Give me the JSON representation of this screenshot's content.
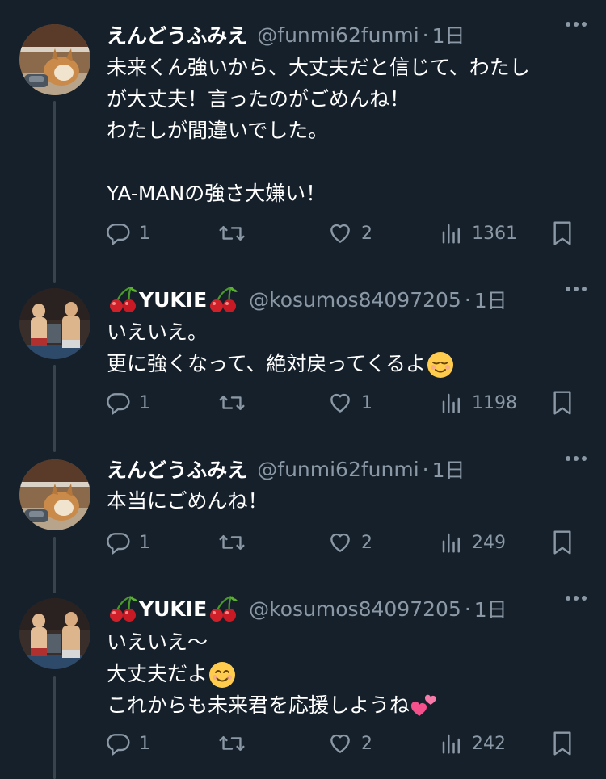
{
  "tweets": [
    {
      "name": "えんどうふみえ",
      "handle": "@funmi62funmi",
      "dot": "·",
      "time": "1日",
      "lines": [
        "未来くん強いから、大丈夫だと信じて、わたし",
        "が大丈夫！言ったのがごめんね！",
        "わたしが間違いでした。",
        "",
        "YA-MANの強さ大嫌い！"
      ],
      "replies": "1",
      "retweets": "",
      "likes": "2",
      "views": "1361"
    },
    {
      "name": "YUKIE",
      "handle": "@kosumos84097205",
      "dot": "·",
      "time": "1日",
      "lines": [
        "いえいえ。",
        "更に強くなって、絶対戻ってくるよ"
      ],
      "replies": "1",
      "retweets": "",
      "likes": "1",
      "views": "1198"
    },
    {
      "name": "えんどうふみえ",
      "handle": "@funmi62funmi",
      "dot": "·",
      "time": "1日",
      "lines": [
        "本当にごめんね！"
      ],
      "replies": "1",
      "retweets": "",
      "likes": "2",
      "views": "249"
    },
    {
      "name": "YUKIE",
      "handle": "@kosumos84097205",
      "dot": "·",
      "time": "1日",
      "lines": [
        "いえいえ〜",
        "大丈夫だよ",
        "これからも未来君を応援しようね"
      ],
      "replies": "1",
      "retweets": "",
      "likes": "2",
      "views": "242"
    }
  ],
  "icons": {
    "reply": "reply-icon",
    "retweet": "retweet-icon",
    "like": "heart-icon",
    "views": "views-icon",
    "bookmark": "bookmark-icon",
    "more": "more-icon",
    "relieved_emoji": "relieved-face-emoji",
    "smile_emoji": "smiling-face-emoji",
    "hearts_emoji": "two-hearts-emoji",
    "cherry_emoji": "cherries-emoji"
  },
  "colors": {
    "background": "#15202b",
    "text": "#ffffff",
    "secondary": "#8b98a5",
    "thread_line": "#38444d"
  }
}
